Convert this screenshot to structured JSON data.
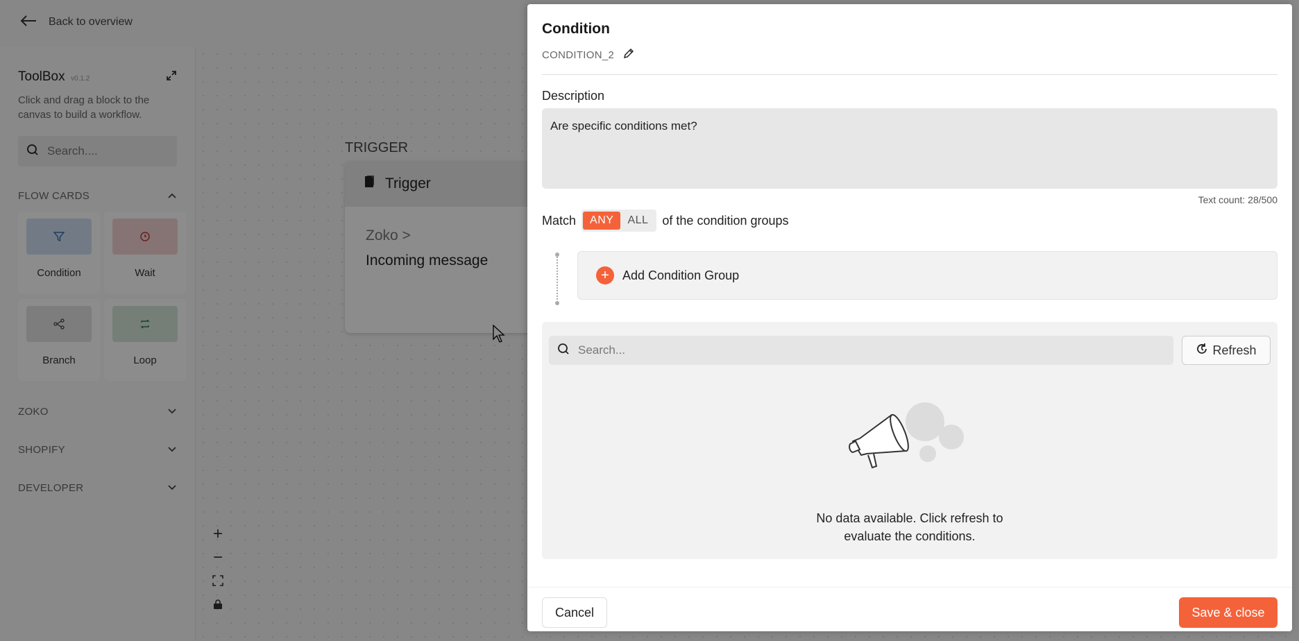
{
  "topbar": {
    "back_label": "Back to overview"
  },
  "toolbox": {
    "title": "ToolBox",
    "version": "v0.1.2",
    "help": "Click and drag a block to the canvas to build a workflow.",
    "search_placeholder": "Search....",
    "flow_cards_label": "FLOW CARDS",
    "cards": [
      {
        "label": "Condition",
        "color": "#cfe0f3",
        "icon": "filter-icon"
      },
      {
        "label": "Wait",
        "color": "#f4d4d4",
        "icon": "clock-icon"
      },
      {
        "label": "Branch",
        "color": "#e4e4e4",
        "icon": "branch-icon"
      },
      {
        "label": "Loop",
        "color": "#d5e8da",
        "icon": "loop-icon"
      }
    ],
    "sections": [
      "ZOKO",
      "SHOPIFY",
      "DEVELOPER"
    ]
  },
  "canvas": {
    "trigger_label": "TRIGGER",
    "trigger_title": "Trigger",
    "trigger_source": "Zoko >",
    "trigger_event": "Incoming message"
  },
  "drawer": {
    "title": "Condition",
    "id": "CONDITION_2",
    "description_label": "Description",
    "description": "Are specific conditions met?",
    "text_count": "Text count: 28/500",
    "match_prefix": "Match",
    "match_options": [
      "ANY",
      "ALL"
    ],
    "match_selected": "ANY",
    "match_suffix": "of the condition groups",
    "add_group_label": "Add Condition Group",
    "search_placeholder": "Search...",
    "refresh_label": "Refresh",
    "empty_line1": "No data available. Click refresh to",
    "empty_line2": "evaluate the conditions.",
    "cancel_label": "Cancel",
    "save_label": "Save & close"
  },
  "colors": {
    "accent": "#f4623a"
  }
}
